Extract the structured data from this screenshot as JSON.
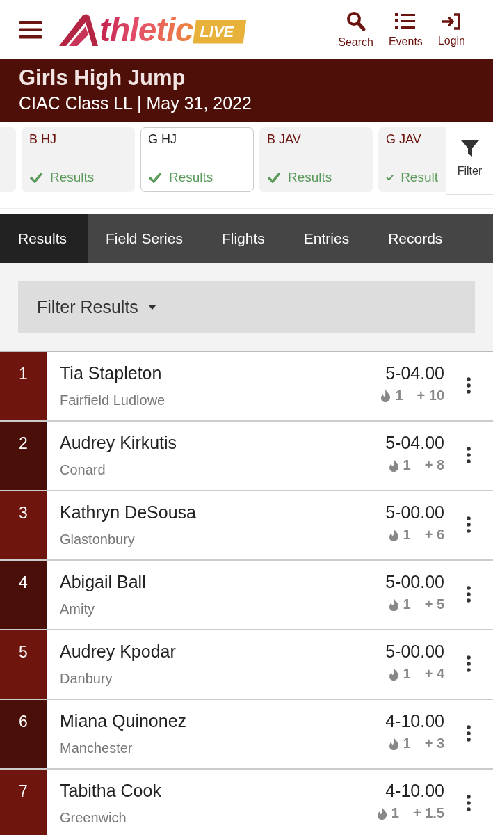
{
  "header": {
    "logo": {
      "text": "thletic",
      "badge": "LIVE"
    },
    "actions": [
      {
        "kind": "search",
        "label": "Search"
      },
      {
        "kind": "events",
        "label": "Events"
      },
      {
        "kind": "login",
        "label": "Login"
      }
    ]
  },
  "banner": {
    "title": "Girls High Jump",
    "subtitle": "CIAC Class LL | May 31, 2022"
  },
  "event_tabs": [
    {
      "code": "B HJ",
      "status": "Results",
      "selected": false
    },
    {
      "code": "G HJ",
      "status": "Results",
      "selected": true
    },
    {
      "code": "B JAV",
      "status": "Results",
      "selected": false
    },
    {
      "code": "G JAV",
      "status": "Result",
      "selected": false
    }
  ],
  "filter_button": {
    "label": "Filter"
  },
  "nav_tabs": [
    {
      "label": "Results",
      "selected": true
    },
    {
      "label": "Field Series",
      "selected": false
    },
    {
      "label": "Flights",
      "selected": false
    },
    {
      "label": "Entries",
      "selected": false
    },
    {
      "label": "Records",
      "selected": false
    }
  ],
  "filter_dropdown": {
    "label": "Filter Results"
  },
  "results": [
    {
      "place": "1",
      "name": "Tia Stapleton",
      "school": "Fairfield Ludlowe",
      "mark": "5-04.00",
      "flame_count": "1",
      "points": "+ 10"
    },
    {
      "place": "2",
      "name": "Audrey Kirkutis",
      "school": "Conard",
      "mark": "5-04.00",
      "flame_count": "1",
      "points": "+ 8"
    },
    {
      "place": "3",
      "name": "Kathryn DeSousa",
      "school": "Glastonbury",
      "mark": "5-00.00",
      "flame_count": "1",
      "points": "+ 6"
    },
    {
      "place": "4",
      "name": "Abigail Ball",
      "school": "Amity",
      "mark": "5-00.00",
      "flame_count": "1",
      "points": "+ 5"
    },
    {
      "place": "5",
      "name": "Audrey Kpodar",
      "school": "Danbury",
      "mark": "5-00.00",
      "flame_count": "1",
      "points": "+ 4"
    },
    {
      "place": "6",
      "name": "Miana Quinonez",
      "school": "Manchester",
      "mark": "4-10.00",
      "flame_count": "1",
      "points": "+ 3"
    },
    {
      "place": "7",
      "name": "Tabitha Cook",
      "school": "Greenwich",
      "mark": "4-10.00",
      "flame_count": "1",
      "points": "+ 1.5"
    }
  ]
}
